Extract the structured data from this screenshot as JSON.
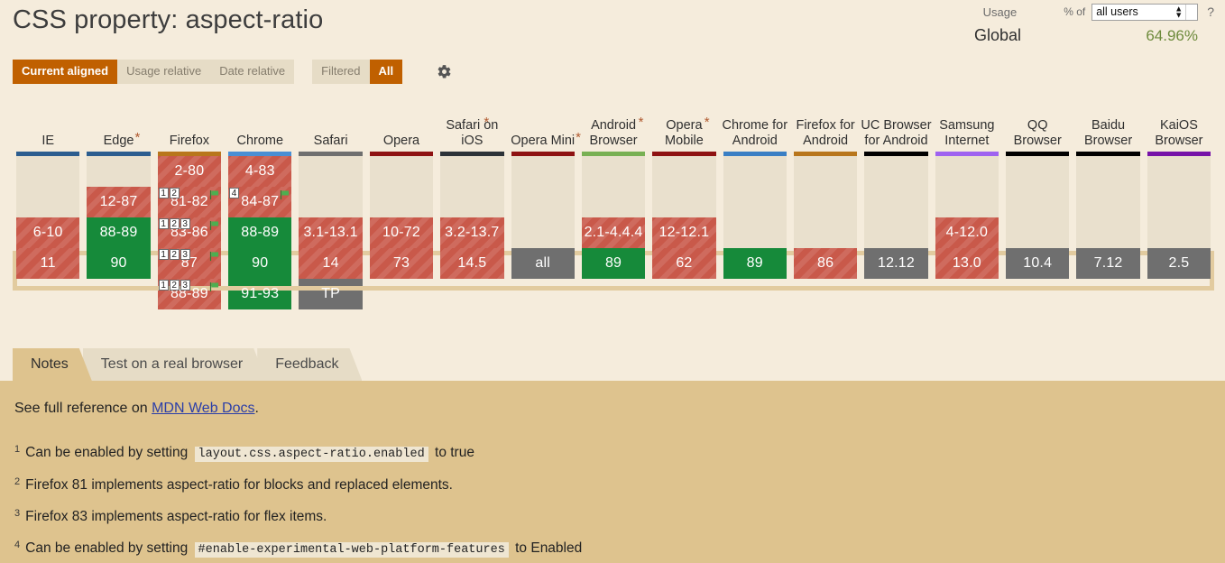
{
  "header": {
    "title": "CSS property: aspect-ratio",
    "usage_label": "Usage",
    "pct_of_label": "% of",
    "usage_select_value": "all users",
    "help_icon": "question-mark-icon",
    "global_label": "Global",
    "global_pct": "64.96%"
  },
  "toolbar": {
    "view_buttons": [
      {
        "label": "Current aligned",
        "active": true
      },
      {
        "label": "Usage relative",
        "active": false
      },
      {
        "label": "Date relative",
        "active": false
      }
    ],
    "filter_buttons": [
      {
        "label": "Filtered",
        "active": false
      },
      {
        "label": "All",
        "active": true
      }
    ],
    "settings_icon": "gear-icon"
  },
  "table": {
    "columns": [
      {
        "name": "IE",
        "star": false,
        "bar": "#2c5d8f"
      },
      {
        "name": "Edge",
        "star": true,
        "bar": "#2c5d8f"
      },
      {
        "name": "Firefox",
        "star": false,
        "bar": "#b8761c"
      },
      {
        "name": "Chrome",
        "star": false,
        "bar": "#4a8fd4"
      },
      {
        "name": "Safari",
        "star": false,
        "bar": "#6f6f6f"
      },
      {
        "name": "Opera",
        "star": false,
        "bar": "#8e1212"
      },
      {
        "name": "Safari on iOS",
        "star": true,
        "bar": "#2c3238"
      },
      {
        "name": "Opera Mini",
        "star": true,
        "bar": "#8e1212"
      },
      {
        "name": "Android Browser",
        "star": true,
        "bar": "#78b053"
      },
      {
        "name": "Opera Mobile",
        "star": true,
        "bar": "#8e1212"
      },
      {
        "name": "Chrome for Android",
        "star": false,
        "bar": "#3a7fc4"
      },
      {
        "name": "Firefox for Android",
        "star": false,
        "bar": "#b8761c"
      },
      {
        "name": "UC Browser for Android",
        "star": false,
        "bar": "#000000"
      },
      {
        "name": "Samsung Internet",
        "star": false,
        "bar": "#9f62f0"
      },
      {
        "name": "QQ Browser",
        "star": false,
        "bar": "#000000"
      },
      {
        "name": "Baidu Browser",
        "star": false,
        "bar": "#000000"
      },
      {
        "name": "KaiOS Browser",
        "star": false,
        "bar": "#7612a8"
      }
    ],
    "rows": [
      [
        {
          "text": "",
          "state": "empty"
        },
        {
          "text": "",
          "state": "empty"
        },
        {
          "text": "2-80",
          "state": "n"
        },
        {
          "text": "4-83",
          "state": "n"
        },
        {
          "text": "",
          "state": "empty"
        },
        {
          "text": "",
          "state": "empty"
        },
        {
          "text": "",
          "state": "empty"
        },
        {
          "text": "",
          "state": "empty"
        },
        {
          "text": "",
          "state": "empty"
        },
        {
          "text": "",
          "state": "empty"
        },
        {
          "text": "",
          "state": "empty"
        },
        {
          "text": "",
          "state": "empty"
        },
        {
          "text": "",
          "state": "empty"
        },
        {
          "text": "",
          "state": "empty"
        },
        {
          "text": "",
          "state": "empty"
        },
        {
          "text": "",
          "state": "empty"
        },
        {
          "text": "",
          "state": "empty"
        }
      ],
      [
        {
          "text": "",
          "state": "empty"
        },
        {
          "text": "12-87",
          "state": "n"
        },
        {
          "text": "81-82",
          "state": "n",
          "notes": [
            "1",
            "2"
          ],
          "flag": true
        },
        {
          "text": "84-87",
          "state": "n",
          "notes": [
            "4"
          ],
          "flag": true
        },
        {
          "text": "",
          "state": "empty"
        },
        {
          "text": "",
          "state": "empty"
        },
        {
          "text": "",
          "state": "empty"
        },
        {
          "text": "",
          "state": "empty"
        },
        {
          "text": "",
          "state": "empty"
        },
        {
          "text": "",
          "state": "empty"
        },
        {
          "text": "",
          "state": "empty"
        },
        {
          "text": "",
          "state": "empty"
        },
        {
          "text": "",
          "state": "empty"
        },
        {
          "text": "",
          "state": "empty"
        },
        {
          "text": "",
          "state": "empty"
        },
        {
          "text": "",
          "state": "empty"
        },
        {
          "text": "",
          "state": "empty"
        }
      ],
      [
        {
          "text": "6-10",
          "state": "n"
        },
        {
          "text": "88-89",
          "state": "y"
        },
        {
          "text": "83-86",
          "state": "n",
          "notes": [
            "1",
            "2",
            "3"
          ],
          "flag": true
        },
        {
          "text": "88-89",
          "state": "y"
        },
        {
          "text": "3.1-13.1",
          "state": "n"
        },
        {
          "text": "10-72",
          "state": "n"
        },
        {
          "text": "3.2-13.7",
          "state": "n"
        },
        {
          "text": "",
          "state": "empty"
        },
        {
          "text": "2.1-4.4.4",
          "state": "n"
        },
        {
          "text": "12-12.1",
          "state": "n"
        },
        {
          "text": "",
          "state": "empty"
        },
        {
          "text": "",
          "state": "empty"
        },
        {
          "text": "",
          "state": "empty"
        },
        {
          "text": "4-12.0",
          "state": "n"
        },
        {
          "text": "",
          "state": "empty"
        },
        {
          "text": "",
          "state": "empty"
        },
        {
          "text": "",
          "state": "empty"
        }
      ],
      [
        {
          "text": "11",
          "state": "n"
        },
        {
          "text": "90",
          "state": "y"
        },
        {
          "text": "87",
          "state": "n",
          "notes": [
            "1",
            "2",
            "3"
          ],
          "flag": true
        },
        {
          "text": "90",
          "state": "y"
        },
        {
          "text": "14",
          "state": "n"
        },
        {
          "text": "73",
          "state": "n"
        },
        {
          "text": "14.5",
          "state": "n"
        },
        {
          "text": "all",
          "state": "u"
        },
        {
          "text": "89",
          "state": "y"
        },
        {
          "text": "62",
          "state": "n"
        },
        {
          "text": "89",
          "state": "y"
        },
        {
          "text": "86",
          "state": "n"
        },
        {
          "text": "12.12",
          "state": "u"
        },
        {
          "text": "13.0",
          "state": "n"
        },
        {
          "text": "10.4",
          "state": "u"
        },
        {
          "text": "7.12",
          "state": "u"
        },
        {
          "text": "2.5",
          "state": "u"
        }
      ],
      [
        {
          "text": "",
          "state": "blank"
        },
        {
          "text": "",
          "state": "blank"
        },
        {
          "text": "88-89",
          "state": "n",
          "notes": [
            "1",
            "2",
            "3"
          ],
          "flag": true
        },
        {
          "text": "91-93",
          "state": "y"
        },
        {
          "text": "TP",
          "state": "u"
        },
        {
          "text": "",
          "state": "blank"
        },
        {
          "text": "",
          "state": "blank"
        },
        {
          "text": "",
          "state": "blank"
        },
        {
          "text": "",
          "state": "blank"
        },
        {
          "text": "",
          "state": "blank"
        },
        {
          "text": "",
          "state": "blank"
        },
        {
          "text": "",
          "state": "blank"
        },
        {
          "text": "",
          "state": "blank"
        },
        {
          "text": "",
          "state": "blank"
        },
        {
          "text": "",
          "state": "blank"
        },
        {
          "text": "",
          "state": "blank"
        },
        {
          "text": "",
          "state": "blank"
        }
      ]
    ]
  },
  "tabs": [
    {
      "label": "Notes",
      "active": true
    },
    {
      "label": "Test on a real browser",
      "active": false
    },
    {
      "label": "Feedback",
      "active": false
    }
  ],
  "notes_panel": {
    "reference_prefix": "See full reference on ",
    "reference_link": "MDN Web Docs",
    "reference_suffix": ".",
    "footnotes": [
      {
        "num": "1",
        "pre": "Can be enabled by setting ",
        "code": "layout.css.aspect-ratio.enabled",
        "post": " to true"
      },
      {
        "num": "2",
        "pre": "Firefox 81 implements aspect-ratio for blocks and replaced elements.",
        "code": "",
        "post": ""
      },
      {
        "num": "3",
        "pre": "Firefox 83 implements aspect-ratio for flex items.",
        "code": "",
        "post": ""
      },
      {
        "num": "4",
        "pre": "Can be enabled by setting ",
        "code": "#enable-experimental-web-platform-features",
        "post": " to Enabled"
      }
    ]
  }
}
